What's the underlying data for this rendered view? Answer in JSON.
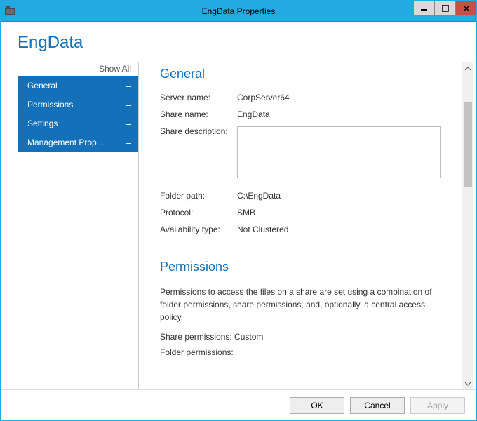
{
  "window": {
    "title": "EngData Properties"
  },
  "header": {
    "title": "EngData"
  },
  "sidebar": {
    "show_all": "Show All",
    "items": [
      {
        "label": "General"
      },
      {
        "label": "Permissions"
      },
      {
        "label": "Settings"
      },
      {
        "label": "Management Prop..."
      }
    ]
  },
  "general": {
    "heading": "General",
    "server_name_label": "Server name:",
    "server_name_value": "CorpServer64",
    "share_name_label": "Share name:",
    "share_name_value": "EngData",
    "share_description_label": "Share description:",
    "share_description_value": "",
    "folder_path_label": "Folder path:",
    "folder_path_value": "C:\\EngData",
    "protocol_label": "Protocol:",
    "protocol_value": "SMB",
    "availability_label": "Availability type:",
    "availability_value": "Not Clustered"
  },
  "permissions": {
    "heading": "Permissions",
    "description": "Permissions to access the files on a share are set using a combination of folder permissions, share permissions, and, optionally, a central access policy.",
    "share_perm_label": "Share permissions: Custom",
    "folder_perm_label": "Folder permissions:"
  },
  "footer": {
    "ok": "OK",
    "cancel": "Cancel",
    "apply": "Apply"
  }
}
